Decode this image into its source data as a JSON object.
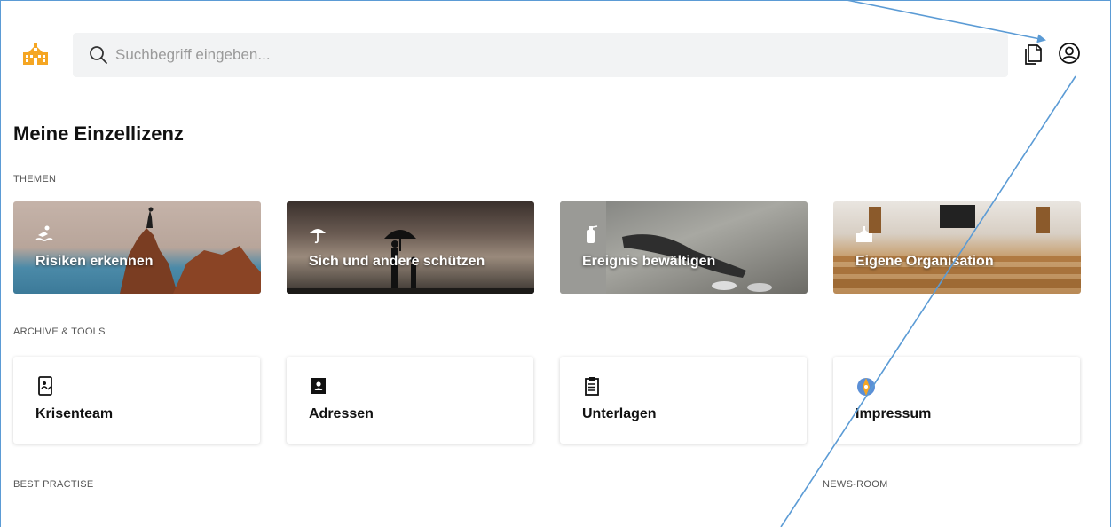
{
  "header": {
    "search_placeholder": "Suchbegriff eingeben..."
  },
  "page": {
    "title": "Meine Einzellizenz"
  },
  "sections": {
    "themen": "THEMEN",
    "archive": "ARCHIVE & TOOLS",
    "best_practise": "BEST PRACTISE",
    "news_room": "NEWS-ROOM"
  },
  "themes": [
    {
      "label": "Risiken erkennen",
      "icon": "swimmer-icon"
    },
    {
      "label": "Sich und andere schützen",
      "icon": "umbrella-icon"
    },
    {
      "label": "Ereignis bewältigen",
      "icon": "fire-extinguisher-icon"
    },
    {
      "label": "Eigene Organisation",
      "icon": "school-building-icon"
    }
  ],
  "tools": [
    {
      "label": "Krisenteam",
      "icon": "phone-contact-icon"
    },
    {
      "label": "Adressen",
      "icon": "address-book-icon"
    },
    {
      "label": "Unterlagen",
      "icon": "clipboard-list-icon"
    },
    {
      "label": "Impressum",
      "icon": "compass-icon"
    }
  ],
  "colors": {
    "accent_logo": "#f5a623",
    "annotation_line": "#5b9bd5",
    "search_bg": "#f2f3f4"
  }
}
